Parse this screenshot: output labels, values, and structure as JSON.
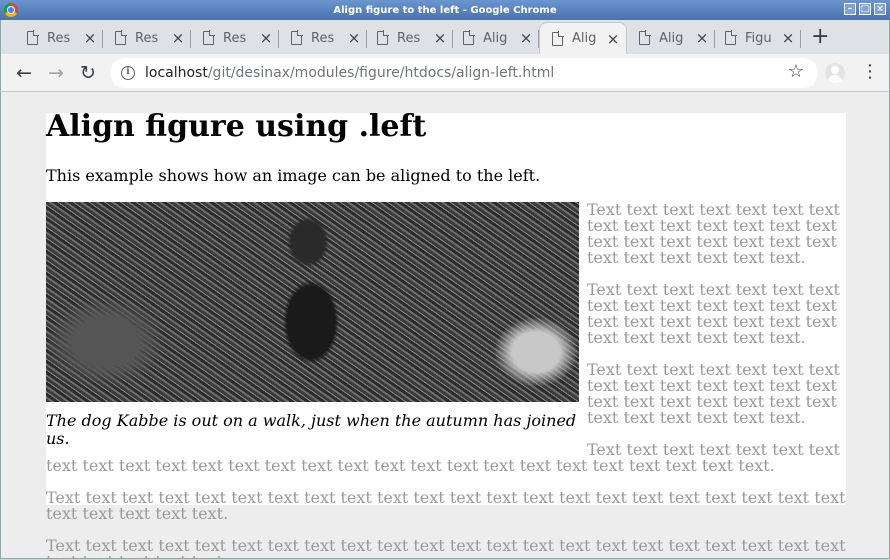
{
  "window": {
    "title": "Align figure to the left - Google Chrome"
  },
  "tabs": [
    {
      "label": "Res"
    },
    {
      "label": "Res"
    },
    {
      "label": "Res"
    },
    {
      "label": "Res"
    },
    {
      "label": "Res"
    },
    {
      "label": "Alig"
    },
    {
      "label": "Alig"
    },
    {
      "label": "Alig"
    },
    {
      "label": "Figu"
    }
  ],
  "active_tab": 6,
  "omnibox": {
    "host": "localhost",
    "path": "/git/desinax/modules/figure/htdocs/align-left.html"
  },
  "page": {
    "heading": "Align figure using .left",
    "intro": "This example shows how an image can be aligned to the left.",
    "figure_caption": "The dog Kabbe is out on a walk, just when the autumn has joined us.",
    "paragraphs": [
      "Text text text text text text text text text text text text text text text text text text text text text text text text text text text.",
      "Text text text text text text text text text text text text text text text text text text text text text text text text text text text.",
      "Text text text text text text text text text text text text text text text text text text text text text text text text text text text.",
      "Text text text text text text text text text text text text text text text text text text text text text text text text text text text.",
      "Text text text text text text text text text text text text text text text text text text text text text text text text text text text.",
      "Text text text text text text text text text text text text text text text text text text text text text text text text text text text."
    ]
  }
}
